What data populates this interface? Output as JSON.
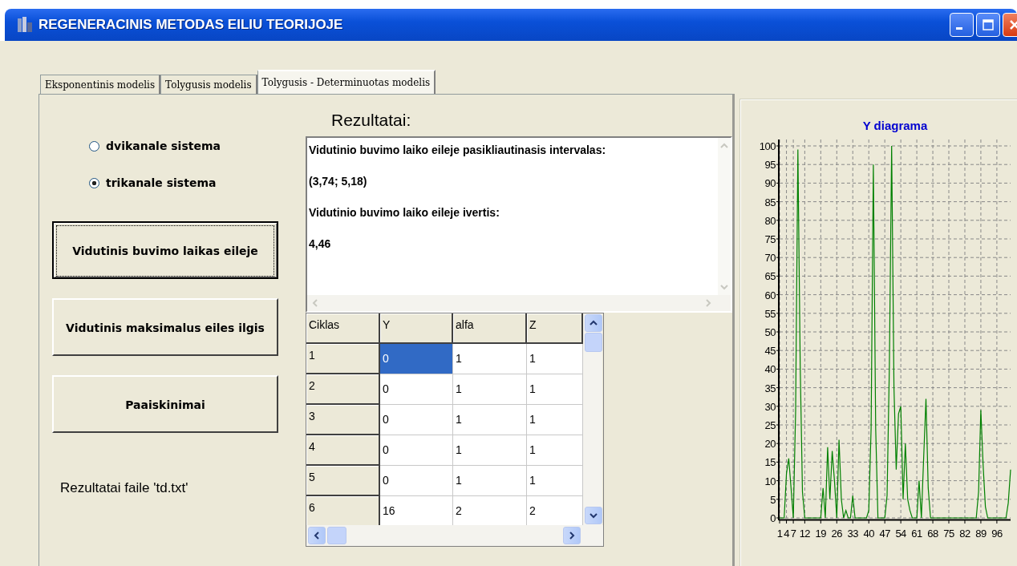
{
  "window": {
    "title": "REGENERACINIS METODAS EILIU TEORIJOJE"
  },
  "tabs": [
    {
      "label": "Eksponentinis modelis",
      "selected": false
    },
    {
      "label": "Tolygusis modelis",
      "selected": false
    },
    {
      "label": "Tolygusis - Determinuotas modelis",
      "selected": true
    }
  ],
  "system": [
    {
      "label": "dvikanale sistema",
      "selected": false
    },
    {
      "label": "trikanale sistema",
      "selected": true
    }
  ],
  "buttons": [
    {
      "label": "Vidutinis buvimo laikas eileje",
      "focused": true
    },
    {
      "label": "Vidutinis maksimalus eiles ilgis",
      "focused": false
    },
    {
      "label": "Paaiskinimai",
      "focused": false
    }
  ],
  "file_note": "Rezultatai faile 'td.txt'",
  "results": {
    "heading": "Rezultatai:",
    "lines": [
      "Vidutinio buvimo laiko eileje pasikliautinasis intervalas:",
      "(3,74; 5,18)",
      "Vidutinio buvimo laiko eileje ivertis:",
      "4,46"
    ]
  },
  "table": {
    "columns": [
      "Ciklas",
      "Y",
      "alfa",
      "Z"
    ],
    "rows": [
      {
        "cells": [
          {
            "text": "1",
            "selected": false
          },
          {
            "text": "0",
            "selected": true
          },
          {
            "text": "1",
            "selected": false
          },
          {
            "text": "1",
            "selected": false
          }
        ]
      },
      {
        "cells": [
          {
            "text": "2",
            "selected": false
          },
          {
            "text": "0",
            "selected": false
          },
          {
            "text": "1",
            "selected": false
          },
          {
            "text": "1",
            "selected": false
          }
        ]
      },
      {
        "cells": [
          {
            "text": "3",
            "selected": false
          },
          {
            "text": "0",
            "selected": false
          },
          {
            "text": "1",
            "selected": false
          },
          {
            "text": "1",
            "selected": false
          }
        ]
      },
      {
        "cells": [
          {
            "text": "4",
            "selected": false
          },
          {
            "text": "0",
            "selected": false
          },
          {
            "text": "1",
            "selected": false
          },
          {
            "text": "1",
            "selected": false
          }
        ]
      },
      {
        "cells": [
          {
            "text": "5",
            "selected": false
          },
          {
            "text": "0",
            "selected": false
          },
          {
            "text": "1",
            "selected": false
          },
          {
            "text": "1",
            "selected": false
          }
        ]
      },
      {
        "cells": [
          {
            "text": "6",
            "selected": false
          },
          {
            "text": "16",
            "selected": false
          },
          {
            "text": "2",
            "selected": false
          },
          {
            "text": "2",
            "selected": false
          }
        ]
      }
    ]
  },
  "diagram": {
    "chart_data": {
      "type": "line",
      "title": "Y diagrama",
      "x": [
        1,
        2,
        3,
        4,
        5,
        6,
        7,
        8,
        9,
        10,
        11,
        12,
        13,
        14,
        15,
        16,
        17,
        18,
        19,
        20,
        21,
        22,
        23,
        24,
        25,
        26,
        27,
        28,
        29,
        30,
        31,
        32,
        33,
        34,
        35,
        36,
        37,
        38,
        39,
        40,
        41,
        42,
        43,
        44,
        45,
        46,
        47,
        48,
        49,
        50,
        51,
        52,
        53,
        54,
        55,
        56,
        57,
        58,
        59,
        60,
        61,
        62,
        63,
        64,
        65,
        66,
        67,
        68,
        69,
        70,
        71,
        72,
        73,
        74,
        75,
        76,
        77,
        78,
        79,
        80,
        81,
        82,
        83,
        84,
        85,
        86,
        87,
        88,
        89,
        90,
        91,
        92,
        93,
        94,
        95,
        96,
        97,
        98,
        99,
        100,
        101,
        102
      ],
      "series": [
        {
          "color": "#008000",
          "values": [
            0,
            0,
            0,
            12,
            16,
            8,
            0,
            29,
            99,
            41,
            7,
            0,
            0,
            0,
            0,
            0,
            0,
            0,
            0,
            8,
            0,
            19,
            5,
            18,
            10,
            0,
            21,
            5,
            0,
            2,
            0,
            0,
            6,
            0,
            0,
            0,
            0,
            0,
            0,
            2,
            24,
            95,
            24,
            0,
            0,
            0,
            0,
            6,
            41,
            100,
            35,
            13,
            28,
            30,
            5,
            20,
            5,
            2,
            0,
            0,
            0,
            10,
            0,
            16,
            32,
            8,
            0,
            0,
            0,
            0,
            0,
            0,
            0,
            0,
            0,
            0,
            0,
            0,
            0,
            0,
            0,
            0,
            0,
            0,
            0,
            0,
            0,
            7,
            29,
            14,
            3,
            0,
            0,
            0,
            0,
            0,
            0,
            0,
            0,
            0,
            4,
            13
          ]
        }
      ],
      "xlim": [
        1,
        102
      ],
      "ylim": [
        0,
        100
      ],
      "grid": true,
      "xticks": [
        1,
        4,
        7,
        12,
        19,
        26,
        33,
        40,
        47,
        54,
        61,
        68,
        75,
        82,
        89,
        96
      ],
      "yticks": [
        0,
        5,
        10,
        15,
        20,
        25,
        30,
        35,
        40,
        45,
        50,
        55,
        60,
        65,
        70,
        75,
        80,
        85,
        90,
        95,
        100
      ]
    }
  }
}
